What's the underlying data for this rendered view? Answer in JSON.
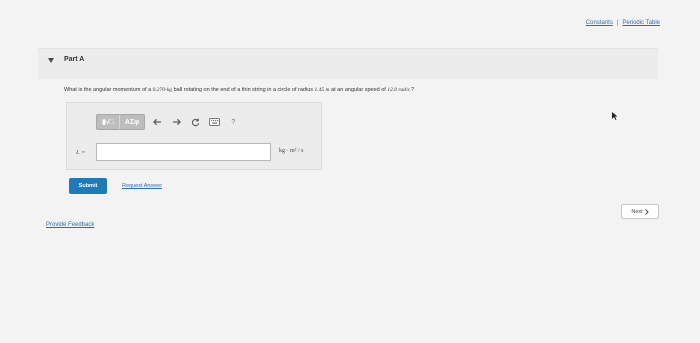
{
  "header": {
    "constants_label": "Constants",
    "separator": "|",
    "periodic_table_label": "Periodic Table"
  },
  "part": {
    "title": "Part A"
  },
  "question": {
    "prefix": "What is the angular momentum of a ",
    "mass": "0.270-kg",
    "mid1": " ball rotating on the end of a thin string in a circle of radius ",
    "radius": "1.45 m",
    "mid2": " at an angular speed of ",
    "speed": "12.0 rad/s",
    "suffix": " ?"
  },
  "answer": {
    "toolbar": {
      "matrix_label": "▮√□",
      "symbols_label": "ΑΣφ",
      "undo_icon": "undo-icon",
      "redo_icon": "redo-icon",
      "reset_icon": "reset-icon",
      "keyboard_icon": "keyboard-icon",
      "help_label": "?"
    },
    "variable_label": "L =",
    "input_value": "",
    "unit": "kg · m² / s"
  },
  "actions": {
    "submit_label": "Submit",
    "request_answer_label": "Request Answer",
    "next_label": "Next"
  },
  "footer": {
    "feedback_label": "Provide Feedback"
  },
  "colors": {
    "accent": "#1d7bb9",
    "link": "#2a6fb0",
    "background": "#f3f3f3"
  }
}
